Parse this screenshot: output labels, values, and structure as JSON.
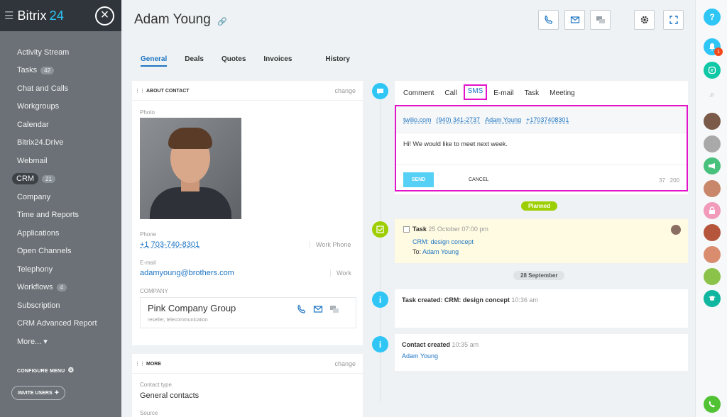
{
  "sidebar": {
    "brand": "Bitrix",
    "brand_num": "24",
    "items": [
      {
        "label": "Activity Stream",
        "count": ""
      },
      {
        "label": "Tasks",
        "count": "42"
      },
      {
        "label": "Chat and Calls",
        "count": ""
      },
      {
        "label": "Workgroups",
        "count": ""
      },
      {
        "label": "Calendar",
        "count": ""
      },
      {
        "label": "Bitrix24.Drive",
        "count": ""
      },
      {
        "label": "Webmail",
        "count": ""
      },
      {
        "label": "CRM",
        "count": "21"
      },
      {
        "label": "Company",
        "count": ""
      },
      {
        "label": "Time and Reports",
        "count": ""
      },
      {
        "label": "Applications",
        "count": ""
      },
      {
        "label": "Open Channels",
        "count": ""
      },
      {
        "label": "Telephony",
        "count": ""
      },
      {
        "label": "Workflows",
        "count": "4"
      },
      {
        "label": "Subscription",
        "count": ""
      },
      {
        "label": "CRM Advanced Report",
        "count": ""
      },
      {
        "label": "More... ▾",
        "count": ""
      }
    ],
    "configure": "CONFIGURE MENU",
    "invite": "INVITE USERS"
  },
  "header": {
    "title": "Adam Young",
    "tabs": [
      "General",
      "Deals",
      "Quotes",
      "Invoices",
      "History"
    ]
  },
  "about": {
    "title": "ABOUT CONTACT",
    "change": "change",
    "photo_label": "Photo",
    "phone_label": "Phone",
    "phone": "+1 703-740-8301",
    "phone_type": "Work Phone",
    "email_label": "E-mail",
    "email": "adamyoung@brothers.com",
    "email_type": "Work",
    "company_label": "COMPANY",
    "company_name": "Pink Company Group",
    "company_sub": "reseller, telecommunication"
  },
  "more": {
    "title": "MORE",
    "change": "change",
    "contact_type_label": "Contact type",
    "contact_type": "General contacts",
    "source_label": "Source"
  },
  "editor": {
    "tabs": [
      "Comment",
      "Call",
      "SMS",
      "E-mail",
      "Task",
      "Meeting"
    ],
    "from_service": "twilio.com",
    "from_number": "(940) 341-2737",
    "to_name": "Adam Young",
    "to_number": "+17037408301",
    "message": "Hi! We would like to meet next week.",
    "send": "SEND",
    "cancel": "CANCEL",
    "counter_used": "37",
    "counter_max": "200"
  },
  "timeline": {
    "planned": "Planned",
    "task_title": "Task",
    "task_date": "25 October 07:00 pm",
    "task_link": "CRM: design concept",
    "task_to_label": "To:",
    "task_to": "Adam Young",
    "date_sep": "28 September",
    "ev1_title": "Task created: CRM: design concept",
    "ev1_time": "10:36 am",
    "ev2_title": "Contact created",
    "ev2_time": "10:35 am",
    "ev2_link": "Adam Young"
  },
  "rightbar": {
    "help": "?",
    "notif_count": "1"
  },
  "colors": {
    "accent": "#1d74c2",
    "highlight": "#e313c9",
    "send": "#56d0f5",
    "planned": "#9dcf00",
    "timeline_blue": "#2fc6f6"
  }
}
